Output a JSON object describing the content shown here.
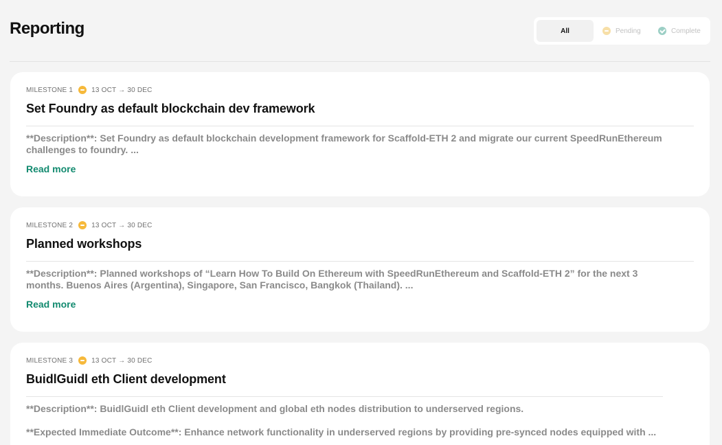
{
  "page": {
    "title": "Reporting"
  },
  "filters": {
    "all": "All",
    "pending": "Pending",
    "complete": "Complete"
  },
  "milestones": [
    {
      "label": "MILESTONE 1",
      "status_icon": "pending-icon",
      "date_range": "13 OCT → 30 DEC",
      "title": "Set Foundry as default blockchain dev framework",
      "description": "**Description**: Set Foundry as default blockchain development framework for Scaffold-ETH 2 and migrate our current SpeedRunEthereum challenges to foundry. ...",
      "read_more": "Read more"
    },
    {
      "label": "MILESTONE 2",
      "status_icon": "pending-icon",
      "date_range": "13 OCT → 30 DEC",
      "title": "Planned workshops",
      "description": "**Description**: Planned workshops of “Learn How To Build On Ethereum with SpeedRunEthereum and Scaffold-ETH 2” for the next 3 months. Buenos Aires (Argentina), Singapore, San Francisco, Bangkok (Thailand). ...",
      "read_more": "Read more"
    },
    {
      "label": "MILESTONE 3",
      "status_icon": "pending-icon",
      "date_range": "13 OCT → 30 DEC",
      "title": "BuidlGuidl eth Client development",
      "description": "**Description**: BuidlGuidl eth Client development and global eth nodes distribution to underserved regions.",
      "expected_outcome": "**Expected Immediate Outcome**: Enhance network functionality in underserved regions by providing pre-synced nodes equipped with ..."
    }
  ],
  "colors": {
    "page_background": "#f4f4f4",
    "card_background": "#ffffff",
    "pending": "#f6b93b",
    "complete": "#9ccfc5",
    "link": "#128a6f"
  }
}
